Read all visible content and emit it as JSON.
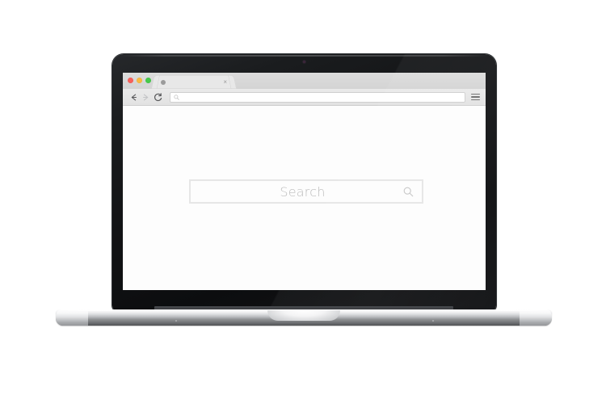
{
  "scene": {
    "device": "laptop",
    "description": "Laptop mockup with open browser window showing a blank page and a centered search field"
  },
  "browser": {
    "traffic_lights": [
      {
        "name": "close",
        "color": "#f9605a"
      },
      {
        "name": "minimize",
        "color": "#f9bb42"
      },
      {
        "name": "zoom",
        "color": "#45ca4a"
      }
    ],
    "tab": {
      "title": "",
      "favicon": "generic-page-icon",
      "close_label": "×"
    },
    "toolbar": {
      "back_icon": "arrow-left-icon",
      "forward_icon": "arrow-right-icon",
      "reload_icon": "reload-icon",
      "menu_icon": "hamburger-menu-icon",
      "address_bar": {
        "value": "",
        "placeholder": "",
        "icon": "search-icon"
      }
    }
  },
  "page": {
    "search": {
      "placeholder": "Search",
      "value": "",
      "icon": "magnifier-icon"
    }
  },
  "colors": {
    "lid": "#121315",
    "screen_background": "#fdfdfd",
    "tabstrip": "#d8d8d8",
    "toolbar": "#e6e6e6",
    "search_border": "#e6e6e6",
    "search_placeholder_text": "#bdbdbd",
    "base_aluminum_light": "#fdfdfd",
    "base_aluminum_dark": "#4e5053"
  }
}
